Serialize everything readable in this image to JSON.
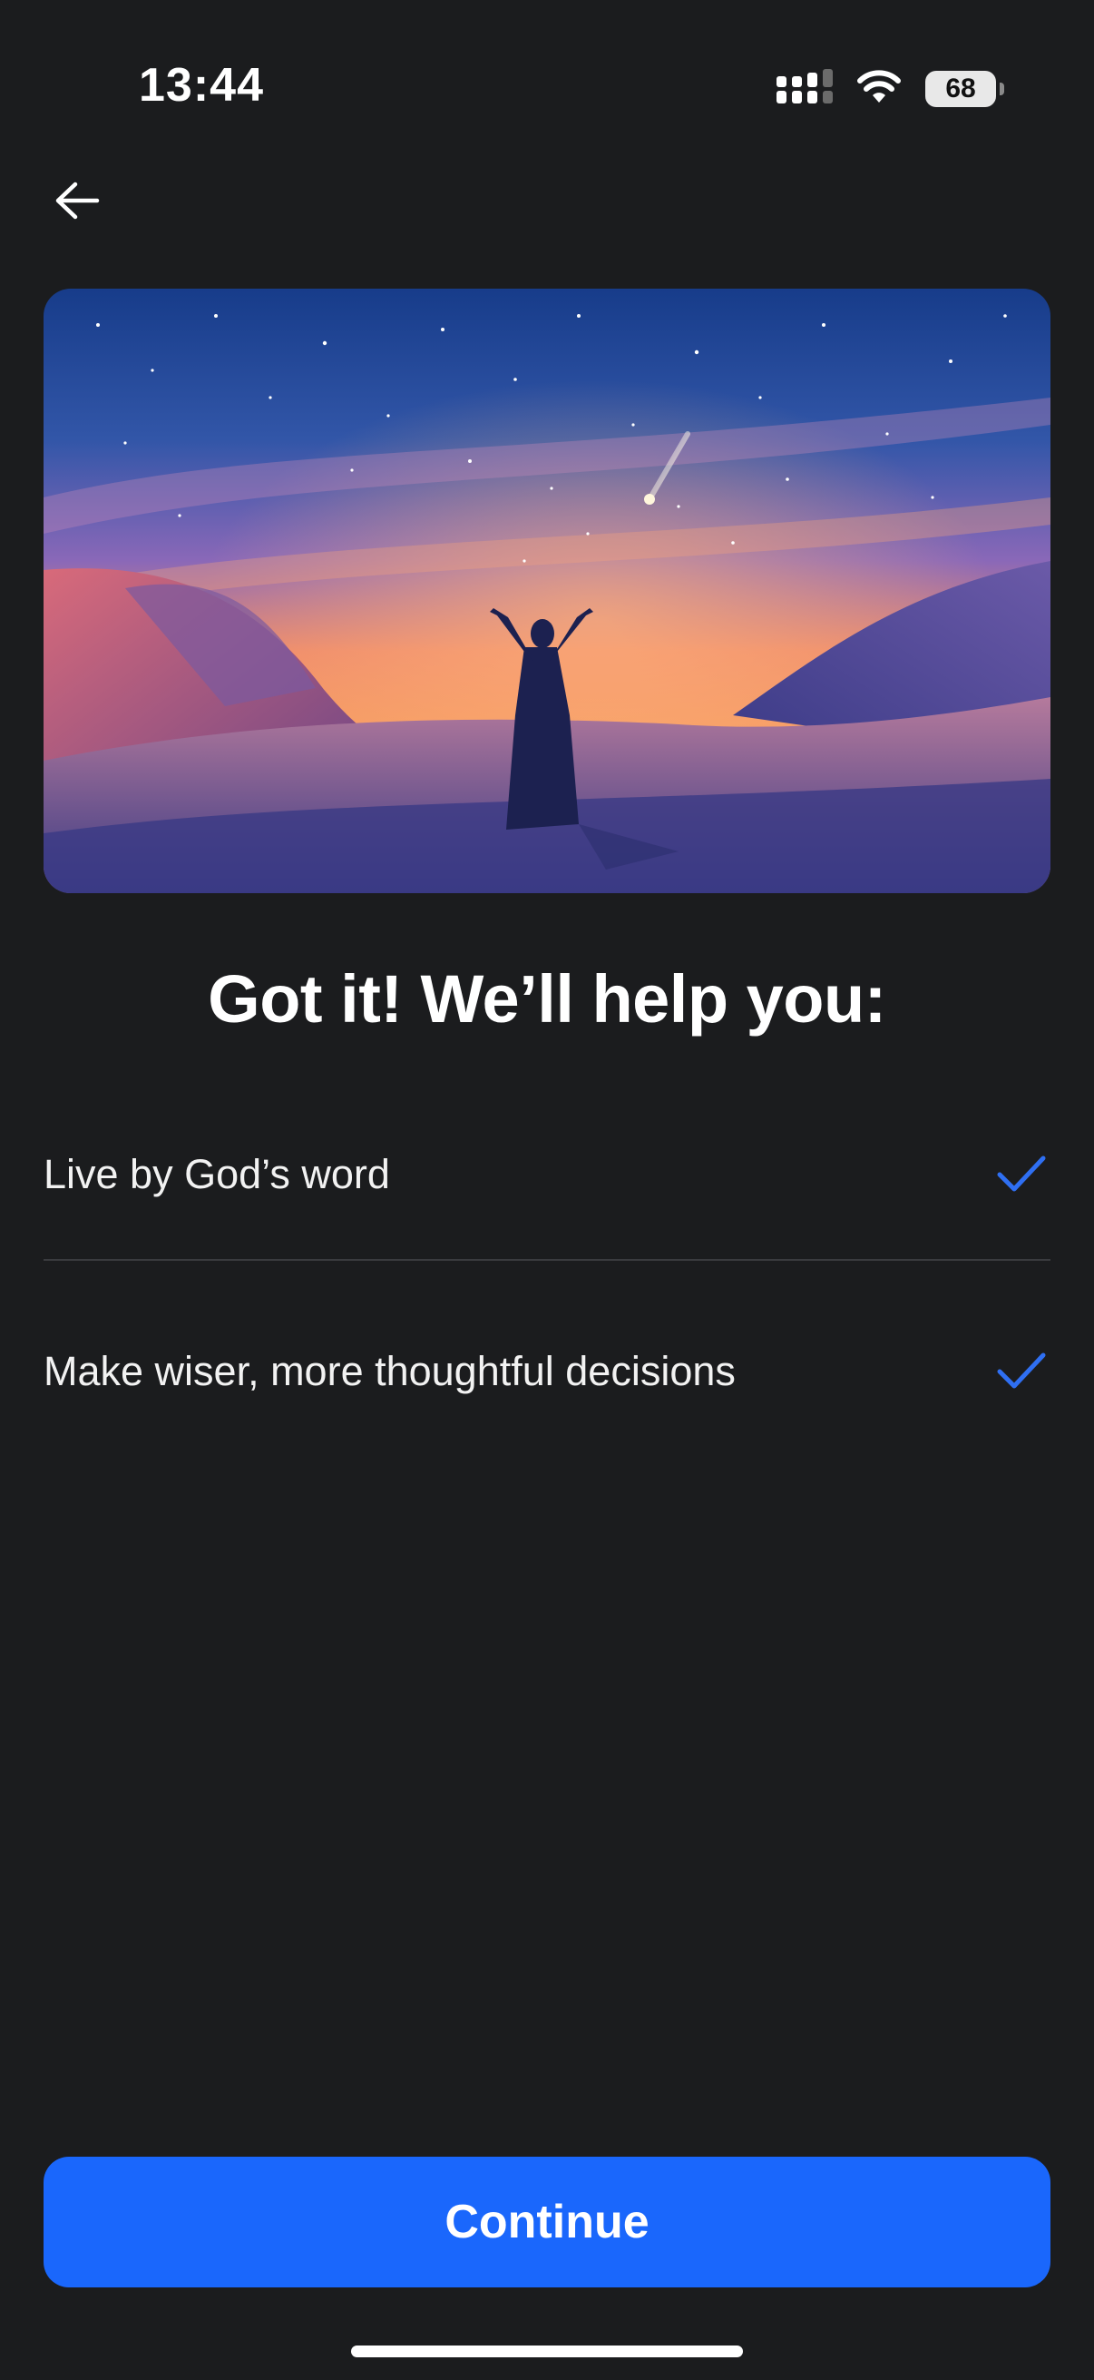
{
  "status_bar": {
    "time": "13:44",
    "battery": "68",
    "icons": [
      "cellular-signal-icon",
      "wifi-icon",
      "battery-icon"
    ]
  },
  "nav": {
    "back_icon": "arrow-left-icon"
  },
  "hero": {
    "description_icon": "desert-night-sky-illustration"
  },
  "heading": "Got it! We’ll help you:",
  "benefits": [
    {
      "label": "Live by God’s word",
      "checked": true
    },
    {
      "label": "Make wiser, more thoughtful decisions",
      "checked": true
    }
  ],
  "continue_label": "Continue",
  "colors": {
    "background": "#1b1c1e",
    "accent": "#1a67fc",
    "check": "#2f6ff2",
    "divider": "#3a3b3f"
  }
}
